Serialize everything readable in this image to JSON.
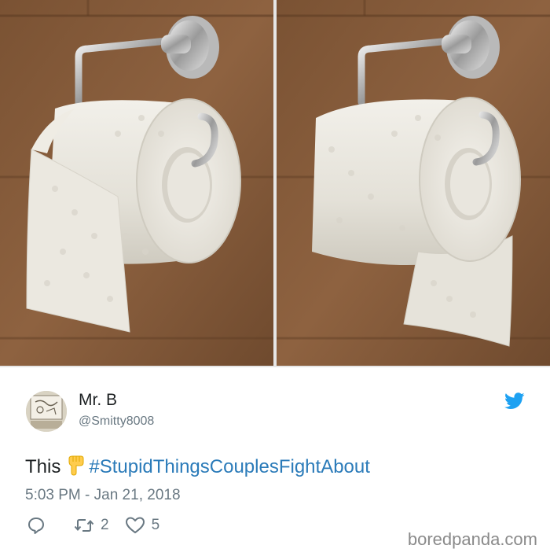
{
  "tweet": {
    "display_name": "Mr. B",
    "handle": "@Smitty8008",
    "text_prefix": "This",
    "emoji_icon": "backhand-index-pointing-down-emoji",
    "hashtag": "#StupidThingsCouplesFightAbout",
    "timestamp": "5:03 PM - Jan 21, 2018",
    "retweet_count": "2",
    "like_count": "5"
  },
  "photos": [
    {
      "name": "toilet-roll-over"
    },
    {
      "name": "toilet-roll-under"
    }
  ],
  "watermark": "boredpanda.com",
  "colors": {
    "hashtag": "#2b7bb9",
    "twitter_blue": "#1da1f2",
    "muted_text": "#697882",
    "tile_wall": "#8a5e3b"
  },
  "icons": [
    "reply-icon",
    "retweet-icon",
    "heart-icon",
    "twitter-bird-icon"
  ]
}
